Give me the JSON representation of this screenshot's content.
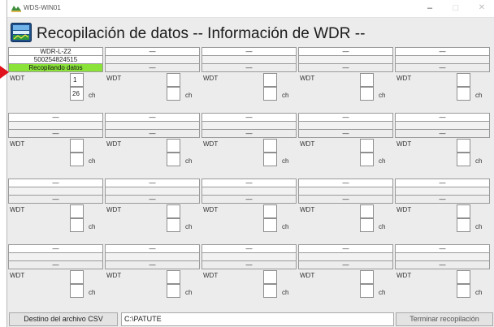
{
  "window": {
    "title_bar_text": "WDS-WIN01",
    "controls": {
      "minimize": "–",
      "maximize": "□",
      "close": "✕"
    },
    "icon": "app-icon"
  },
  "header": {
    "title": "Recopilación de datos -- Información de WDR --",
    "icon": "data-collection-icon"
  },
  "units": [
    {
      "row1": "WDR-L-Z2",
      "row2": "500254824515",
      "row3": "Recopilando datos",
      "status": "collecting",
      "wdt_label": "WDT",
      "wdt_value": "1",
      "ch_value": "26",
      "ch_label": "ch"
    },
    {
      "row1": "—",
      "row2": "",
      "row3": "—",
      "wdt_label": "WDT",
      "wdt_value": "",
      "ch_value": "",
      "ch_label": "ch"
    },
    {
      "row1": "—",
      "row2": "",
      "row3": "—",
      "wdt_label": "WDT",
      "wdt_value": "",
      "ch_value": "",
      "ch_label": "ch"
    },
    {
      "row1": "—",
      "row2": "",
      "row3": "—",
      "wdt_label": "WDT",
      "wdt_value": "",
      "ch_value": "",
      "ch_label": "ch"
    },
    {
      "row1": "—",
      "row2": "",
      "row3": "—",
      "wdt_label": "WDT",
      "wdt_value": "",
      "ch_value": "",
      "ch_label": "ch"
    },
    {
      "row1": "—",
      "row2": "",
      "row3": "—",
      "wdt_label": "WDT",
      "wdt_value": "",
      "ch_value": "",
      "ch_label": "ch"
    },
    {
      "row1": "—",
      "row2": "",
      "row3": "—",
      "wdt_label": "WDT",
      "wdt_value": "",
      "ch_value": "",
      "ch_label": "ch"
    },
    {
      "row1": "—",
      "row2": "",
      "row3": "—",
      "wdt_label": "WDT",
      "wdt_value": "",
      "ch_value": "",
      "ch_label": "ch"
    },
    {
      "row1": "—",
      "row2": "",
      "row3": "—",
      "wdt_label": "WDT",
      "wdt_value": "",
      "ch_value": "",
      "ch_label": "ch"
    },
    {
      "row1": "—",
      "row2": "",
      "row3": "—",
      "wdt_label": "WDT",
      "wdt_value": "",
      "ch_value": "",
      "ch_label": "ch"
    },
    {
      "row1": "—",
      "row2": "",
      "row3": "—",
      "wdt_label": "WDT",
      "wdt_value": "",
      "ch_value": "",
      "ch_label": "ch"
    },
    {
      "row1": "—",
      "row2": "",
      "row3": "—",
      "wdt_label": "WDT",
      "wdt_value": "",
      "ch_value": "",
      "ch_label": "ch"
    },
    {
      "row1": "—",
      "row2": "",
      "row3": "—",
      "wdt_label": "WDT",
      "wdt_value": "",
      "ch_value": "",
      "ch_label": "ch"
    },
    {
      "row1": "—",
      "row2": "",
      "row3": "—",
      "wdt_label": "WDT",
      "wdt_value": "",
      "ch_value": "",
      "ch_label": "ch"
    },
    {
      "row1": "—",
      "row2": "",
      "row3": "—",
      "wdt_label": "WDT",
      "wdt_value": "",
      "ch_value": "",
      "ch_label": "ch"
    },
    {
      "row1": "—",
      "row2": "",
      "row3": "—",
      "wdt_label": "WDT",
      "wdt_value": "",
      "ch_value": "",
      "ch_label": "ch"
    },
    {
      "row1": "—",
      "row2": "",
      "row3": "—",
      "wdt_label": "WDT",
      "wdt_value": "",
      "ch_value": "",
      "ch_label": "ch"
    },
    {
      "row1": "—",
      "row2": "",
      "row3": "—",
      "wdt_label": "WDT",
      "wdt_value": "",
      "ch_value": "",
      "ch_label": "ch"
    },
    {
      "row1": "—",
      "row2": "",
      "row3": "—",
      "wdt_label": "WDT",
      "wdt_value": "",
      "ch_value": "",
      "ch_label": "ch"
    },
    {
      "row1": "—",
      "row2": "",
      "row3": "—",
      "wdt_label": "WDT",
      "wdt_value": "",
      "ch_value": "",
      "ch_label": "ch"
    }
  ],
  "footer": {
    "csv_button": "Destino del archivo CSV",
    "csv_path": "C:\\PATUTE",
    "end_button": "Terminar recopilación"
  },
  "colors": {
    "status_collecting": "#8be33a",
    "pointer_arrow": "#e0121b"
  }
}
